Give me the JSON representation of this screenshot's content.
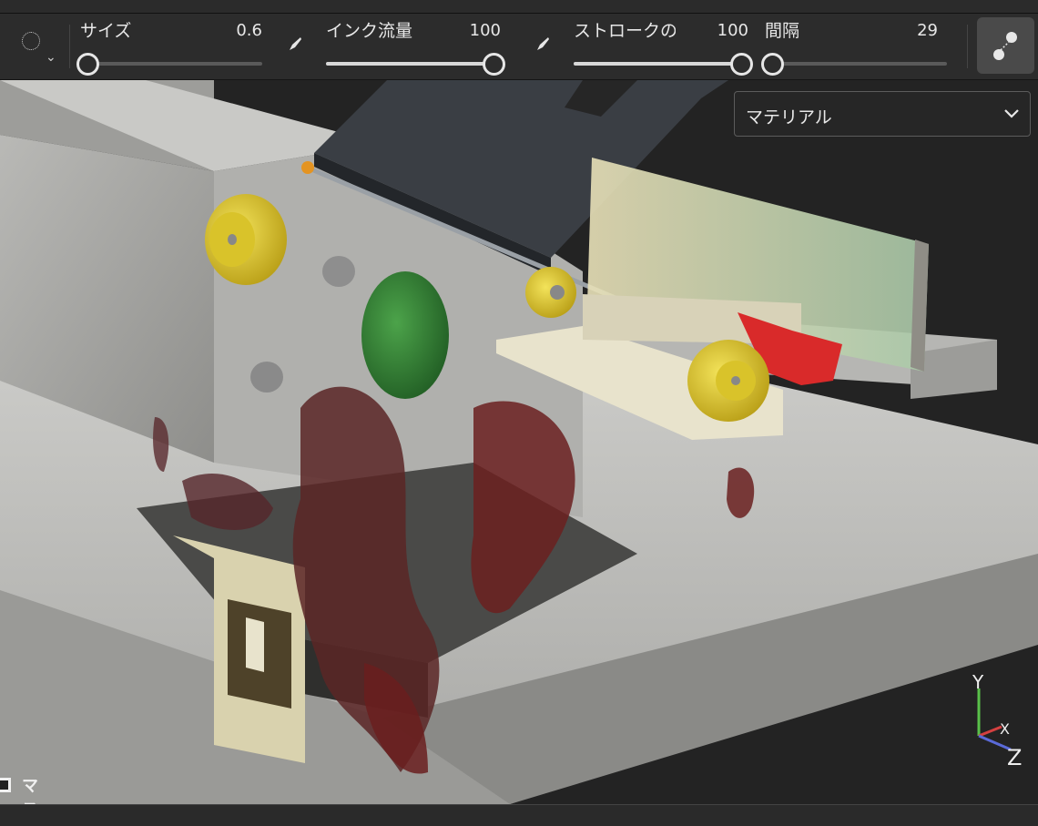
{
  "toolbar": {
    "brush_icon": "dotted-circle-icon",
    "size": {
      "label": "サイズ",
      "value": "0.6",
      "fraction": 0.04
    },
    "ink_flow": {
      "label": "インク流量",
      "value": "100",
      "fraction": 1.0
    },
    "stroke": {
      "label": "ストロークの不",
      "value": "100",
      "fraction": 1.0
    },
    "spacing": {
      "label": "間隔",
      "value": "29",
      "fraction": 0.04
    }
  },
  "viewport": {
    "material_select": "マテリアル",
    "mask_label": "マスク",
    "gizmo": {
      "y": "Y",
      "x": "X",
      "z": "Z"
    }
  }
}
